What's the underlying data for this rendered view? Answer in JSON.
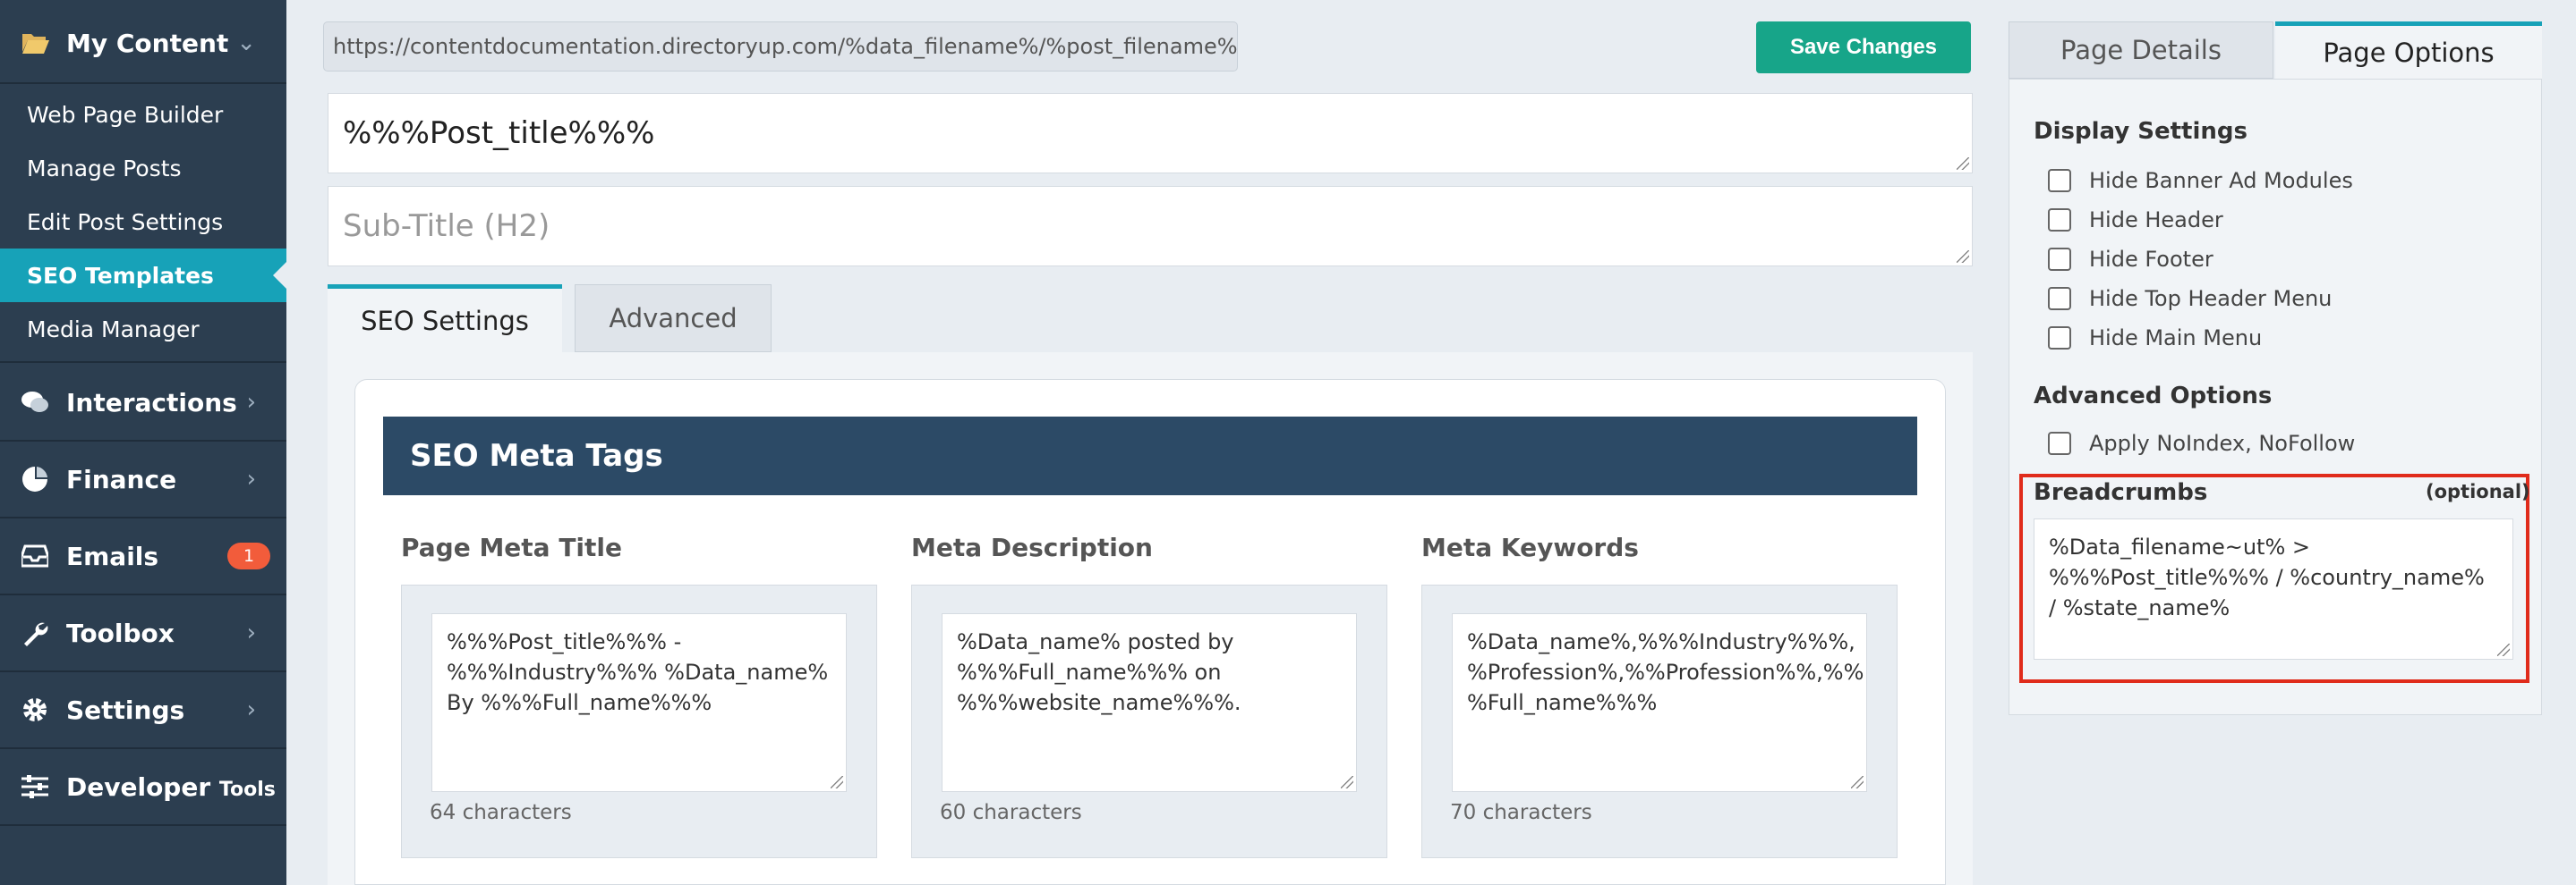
{
  "sidebar": {
    "my_content": "My Content",
    "sub_items": [
      "Web Page Builder",
      "Manage Posts",
      "Edit Post Settings",
      "SEO Templates",
      "Media Manager"
    ],
    "interactions": "Interactions",
    "finance": "Finance",
    "emails": "Emails",
    "emails_badge": "1",
    "toolbox": "Toolbox",
    "settings": "Settings",
    "developer": "Developer",
    "developer_small": "Tools"
  },
  "main": {
    "url": "https://contentdocumentation.directoryup.com/%data_filename%/%post_filename%",
    "save_label": "Save Changes",
    "title_value": "%%%Post_title%%%",
    "subtitle_placeholder": "Sub-Title (H2)",
    "tabs": [
      "SEO Settings",
      "Advanced"
    ],
    "meta_header": "SEO Meta Tags",
    "columns": [
      {
        "label": "Page Meta Title",
        "value": "%%%Post_title%%% - %%%Industry%%% %Data_name% By %%%Full_name%%%",
        "count": "64 characters"
      },
      {
        "label": "Meta Description",
        "value": "%Data_name% posted by %%%Full_name%%% on %%%website_name%%%.",
        "count": "60 characters"
      },
      {
        "label": "Meta Keywords",
        "value": "%Data_name%,%%%Industry%%%, %Profession%,%%Profession%%,%% %Full_name%%%",
        "count": "70 characters"
      }
    ]
  },
  "right_panel": {
    "tabs": [
      "Page Details",
      "Page Options"
    ],
    "display_settings": "Display Settings",
    "checkboxes": [
      "Hide Banner Ad Modules",
      "Hide Header",
      "Hide Footer",
      "Hide Top Header Menu",
      "Hide Main Menu"
    ],
    "advanced_options": "Advanced Options",
    "advanced_checkbox": "Apply NoIndex, NoFollow",
    "breadcrumbs_label": "Breadcrumbs",
    "breadcrumbs_optional": "(optional)",
    "breadcrumbs_value": "%Data_filename~ut% > %%%Post_title%%% / %country_name% / %state_name%"
  },
  "colors": {
    "sidebar_bg": "#2c3e50",
    "accent": "#17a2b8",
    "save_button": "#17a589",
    "highlight": "#e02b1b",
    "badge": "#f25c3b"
  }
}
